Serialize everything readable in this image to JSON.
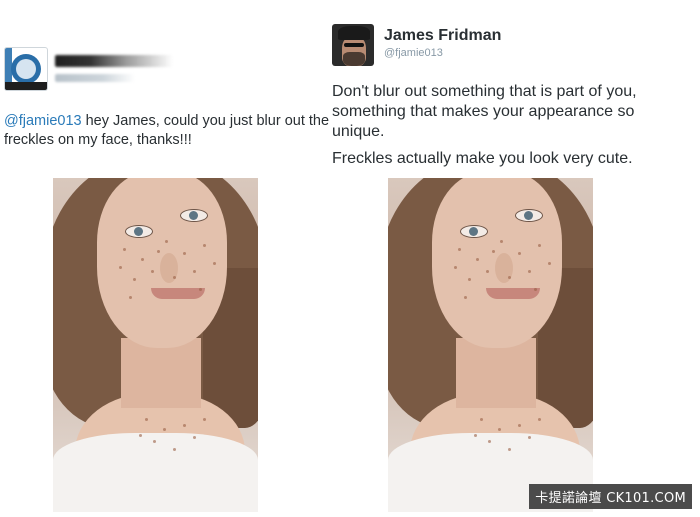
{
  "left_tweet": {
    "avatar_icon": "profile-avatar-icon",
    "mention": "@fjamie013",
    "text": " hey James, could you just blur out the freckles on my face, thanks!!!"
  },
  "right_tweet": {
    "avatar_icon": "profile-avatar-icon",
    "name": "James Fridman",
    "handle": "@fjamie013",
    "paragraph_1": "Don't blur out something that is part of you, something that makes your appearance so unique.",
    "paragraph_2": "Freckles actually make you look very cute."
  },
  "watermark": "卡提諾論壇 CK101.COM",
  "colors": {
    "mention": "#2b7bb9",
    "text": "#292f33",
    "handle": "#8899a6"
  }
}
